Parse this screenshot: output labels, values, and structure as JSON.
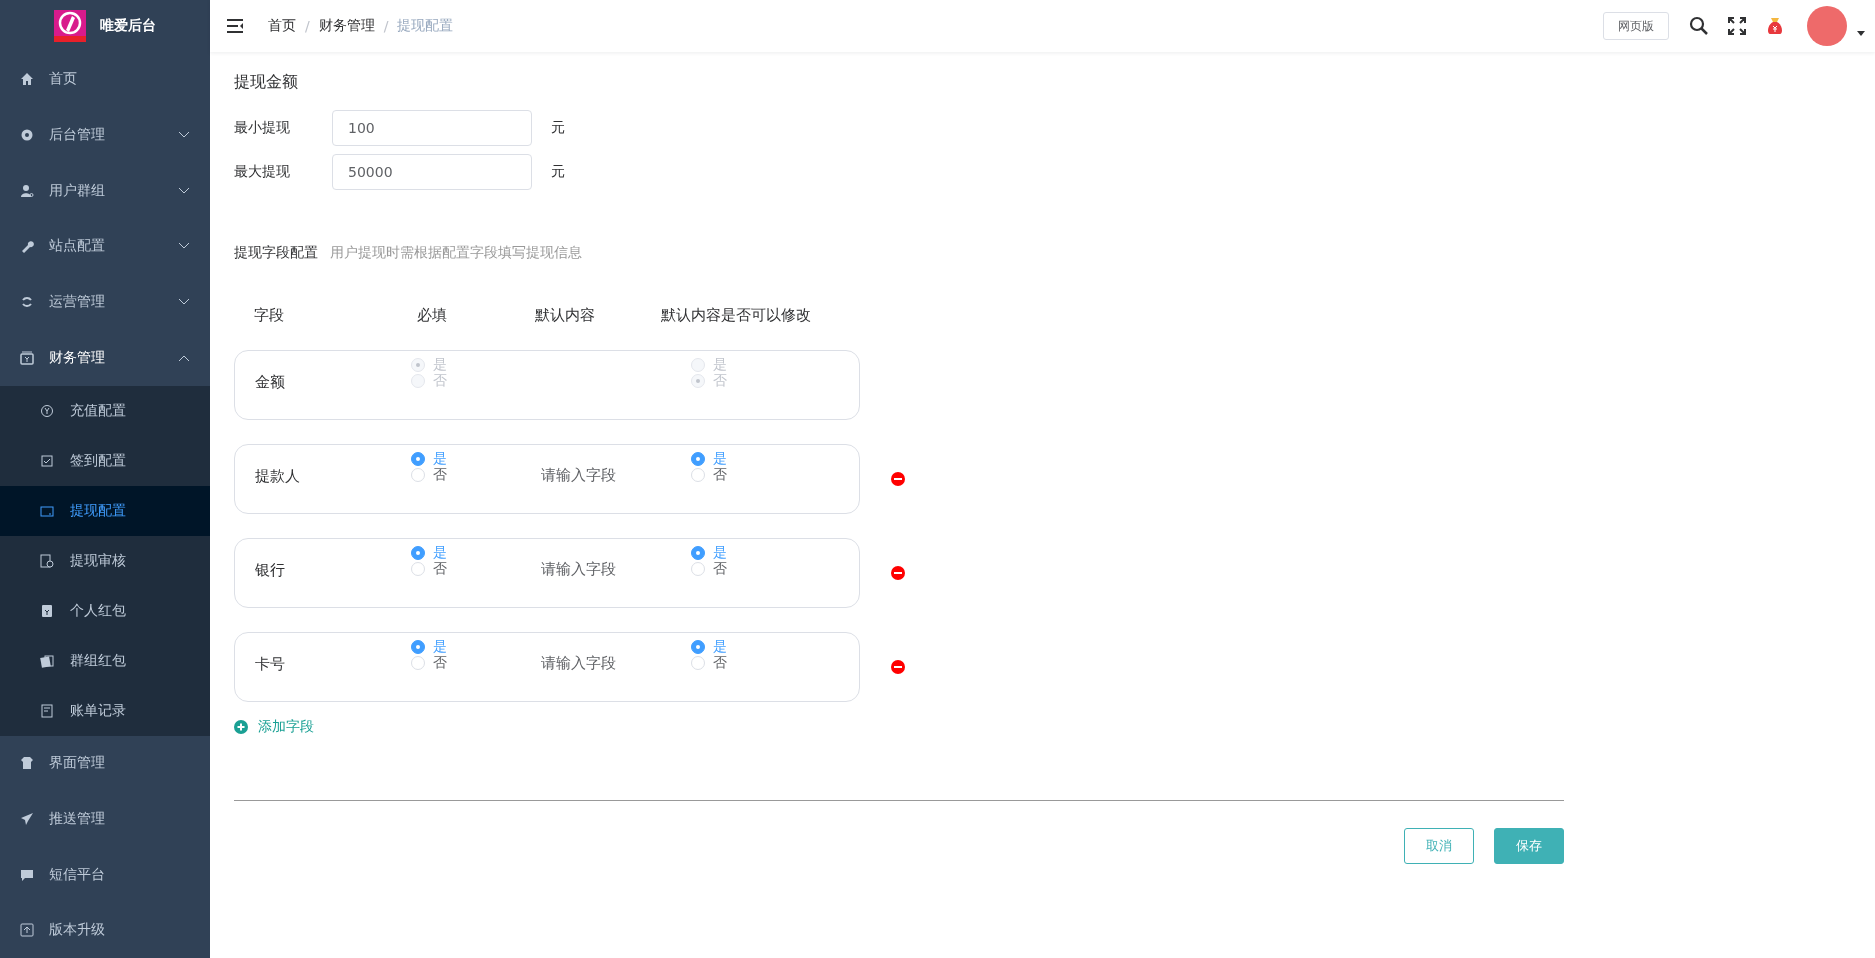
{
  "sidebar": {
    "brand": "唯爱后台",
    "items": [
      {
        "label": "首页",
        "selected": false
      },
      {
        "label": "后台管理",
        "expanded": false,
        "selected": false
      },
      {
        "label": "用户群组",
        "expanded": false,
        "selected": false
      },
      {
        "label": "站点配置",
        "expanded": false,
        "selected": false
      },
      {
        "label": "运营管理",
        "expanded": false,
        "selected": false
      },
      {
        "label": "财务管理",
        "expanded": true,
        "selected": false,
        "children": [
          {
            "label": "充值配置",
            "selected": false
          },
          {
            "label": "签到配置",
            "selected": false
          },
          {
            "label": "提现配置",
            "selected": true
          },
          {
            "label": "提现审核",
            "selected": false
          },
          {
            "label": "个人红包",
            "selected": false
          },
          {
            "label": "群组红包",
            "selected": false
          },
          {
            "label": "账单记录",
            "selected": false
          }
        ]
      },
      {
        "label": "界面管理",
        "selected": false
      },
      {
        "label": "推送管理",
        "selected": false
      },
      {
        "label": "短信平台",
        "selected": false
      },
      {
        "label": "版本升级",
        "selected": false
      }
    ]
  },
  "header": {
    "breadcrumb": [
      "首页",
      "财务管理",
      "提现配置"
    ],
    "separators": [
      "/",
      "/"
    ],
    "web_button": "网页版"
  },
  "amount": {
    "title": "提现金额",
    "fields": [
      {
        "label": "最小提现",
        "value": "100",
        "unit": "元"
      },
      {
        "label": "最大提现",
        "value": "50000",
        "unit": "元"
      }
    ]
  },
  "field_config": {
    "title": "提现字段配置",
    "hint": "用户提现时需根据配置字段填写提现信息",
    "columns": [
      "字段",
      "必填",
      "默认内容",
      "默认内容是否可以修改"
    ],
    "rows": [
      {
        "name": "金额",
        "disabled": true,
        "removable": false,
        "required": [
          {
            "label": "是",
            "selected": true
          },
          {
            "label": "否",
            "selected": false
          }
        ],
        "editable": [
          {
            "label": "是",
            "selected": false
          },
          {
            "label": "否",
            "selected": true
          }
        ]
      },
      {
        "name": "提款人",
        "disabled": false,
        "removable": true,
        "placeholder": "请输入字段",
        "required": [
          {
            "label": "是",
            "selected": true
          },
          {
            "label": "否",
            "selected": false
          }
        ],
        "editable": [
          {
            "label": "是",
            "selected": true
          },
          {
            "label": "否",
            "selected": false
          }
        ]
      },
      {
        "name": "银行",
        "disabled": false,
        "removable": true,
        "placeholder": "请输入字段",
        "required": [
          {
            "label": "是",
            "selected": true
          },
          {
            "label": "否",
            "selected": false
          }
        ],
        "editable": [
          {
            "label": "是",
            "selected": true
          },
          {
            "label": "否",
            "selected": false
          }
        ]
      },
      {
        "name": "卡号",
        "disabled": false,
        "removable": true,
        "placeholder": "请输入字段",
        "required": [
          {
            "label": "是",
            "selected": true
          },
          {
            "label": "否",
            "selected": false
          }
        ],
        "editable": [
          {
            "label": "是",
            "selected": true
          },
          {
            "label": "否",
            "selected": false
          }
        ]
      }
    ],
    "add_label": "添加字段"
  },
  "buttons": {
    "cancel": "取消",
    "save": "保存"
  }
}
